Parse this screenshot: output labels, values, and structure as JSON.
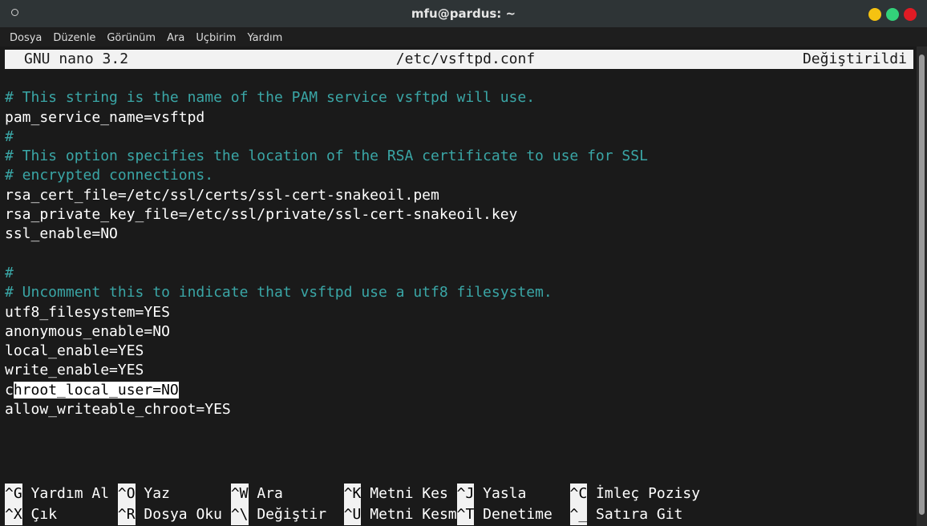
{
  "window": {
    "title": "mfu@pardus: ~",
    "colors": {
      "minimize": "#f5c211",
      "maximize": "#33d17a",
      "close": "#e01b24"
    }
  },
  "menubar": [
    "Dosya",
    "Düzenle",
    "Görünüm",
    "Ara",
    "Uçbirim",
    "Yardım"
  ],
  "nano": {
    "version": "GNU nano 3.2",
    "filename": "/etc/vsftpd.conf",
    "status": "Değiştirildi"
  },
  "editor_lines": [
    {
      "text": "",
      "type": "plain"
    },
    {
      "text": "# This string is the name of the PAM service vsftpd will use.",
      "type": "comment"
    },
    {
      "text": "pam_service_name=vsftpd",
      "type": "plain"
    },
    {
      "text": "#",
      "type": "comment"
    },
    {
      "text": "# This option specifies the location of the RSA certificate to use for SSL",
      "type": "comment"
    },
    {
      "text": "# encrypted connections.",
      "type": "comment"
    },
    {
      "text": "rsa_cert_file=/etc/ssl/certs/ssl-cert-snakeoil.pem",
      "type": "plain"
    },
    {
      "text": "rsa_private_key_file=/etc/ssl/private/ssl-cert-snakeoil.key",
      "type": "plain"
    },
    {
      "text": "ssl_enable=NO",
      "type": "plain"
    },
    {
      "text": "",
      "type": "plain"
    },
    {
      "text": "#",
      "type": "comment"
    },
    {
      "text": "# Uncomment this to indicate that vsftpd use a utf8 filesystem.",
      "type": "comment"
    },
    {
      "text": "utf8_filesystem=YES",
      "type": "plain"
    },
    {
      "text": "anonymous_enable=NO",
      "type": "plain"
    },
    {
      "text": "local_enable=YES",
      "type": "plain"
    },
    {
      "text": "write_enable=YES",
      "type": "plain"
    },
    {
      "text": "chroot_local_user=NO",
      "type": "selected",
      "unselected_prefix": "c",
      "selected_part": "hroot_local_user=NO"
    },
    {
      "text": "allow_writeable_chroot=YES",
      "type": "plain"
    }
  ],
  "shortcuts": [
    [
      {
        "key": "^G",
        "label": " Yardım Al "
      },
      {
        "key": "^O",
        "label": " Yaz       "
      },
      {
        "key": "^W",
        "label": " Ara       "
      },
      {
        "key": "^K",
        "label": " Metni Kes "
      },
      {
        "key": "^J",
        "label": " Yasla     "
      },
      {
        "key": "^C",
        "label": " İmleç Pozisy"
      }
    ],
    [
      {
        "key": "^X",
        "label": " Çık       "
      },
      {
        "key": "^R",
        "label": " Dosya Oku "
      },
      {
        "key": "^\\",
        "label": " Değiştir  "
      },
      {
        "key": "^U",
        "label": " Metni Kesm"
      },
      {
        "key": "^T",
        "label": " Denetime  "
      },
      {
        "key": "^_",
        "label": " Satıra Git"
      }
    ]
  ]
}
